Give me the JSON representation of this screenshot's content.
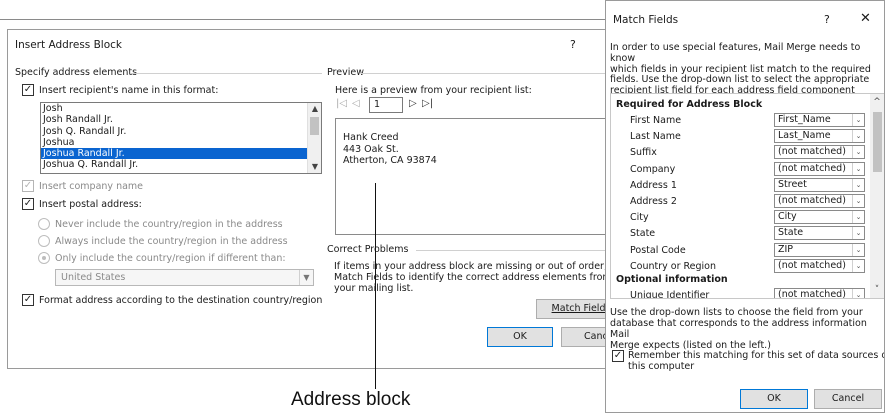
{
  "insert_dialog": {
    "title": "Insert Address Block",
    "help": "?",
    "specify_label": "Specify address elements",
    "insert_name_label": "Insert recipient's name in this format:",
    "name_formats": [
      {
        "label": "Josh",
        "selected": false
      },
      {
        "label": "Josh Randall Jr.",
        "selected": false
      },
      {
        "label": "Josh Q. Randall Jr.",
        "selected": false
      },
      {
        "label": "Joshua",
        "selected": false
      },
      {
        "label": "Joshua Randall Jr.",
        "selected": true
      },
      {
        "label": "Joshua Q. Randall Jr.",
        "selected": false
      }
    ],
    "insert_company_label": "Insert company name",
    "insert_postal_label": "Insert postal address:",
    "radio_never": "Never include the country/region in the address",
    "radio_always": "Always include the country/region in the address",
    "radio_only": "Only include the country/region if different than:",
    "country_value": "United States",
    "format_label": "Format address according to the destination country/region",
    "preview_label": "Preview",
    "preview_hint": "Here is a preview from your recipient list:",
    "preview_index": "1",
    "preview_address": [
      "Hank Creed",
      "443 Oak St.",
      "Atherton, CA 93874"
    ],
    "correct_problems_label": "Correct Problems",
    "problems_text": [
      "If items in your address block are missing or out of order, u",
      "Match Fields to identify the correct address elements from",
      "your mailing list."
    ],
    "match_fields_button": "Match Fields",
    "ok_button": "OK",
    "cancel_button": "Cance"
  },
  "callout": {
    "label": "Address block"
  },
  "match_dialog": {
    "title": "Match Fields",
    "help": "?",
    "close": "✕",
    "intro": [
      "In order to use special features, Mail Merge needs to know",
      "which fields in your recipient list match to the required",
      "fields.  Use the drop-down list to select the appropriate",
      "recipient list field for each address field component"
    ],
    "required_heading": "Required for Address Block",
    "required_fields": [
      {
        "name": "First Name",
        "value": "First_Name"
      },
      {
        "name": "Last Name",
        "value": "Last_Name"
      },
      {
        "name": "Suffix",
        "value": "(not matched)"
      },
      {
        "name": "Company",
        "value": "(not matched)"
      },
      {
        "name": "Address 1",
        "value": "Street"
      },
      {
        "name": "Address 2",
        "value": "(not matched)"
      },
      {
        "name": "City",
        "value": "City"
      },
      {
        "name": "State",
        "value": "State"
      },
      {
        "name": "Postal Code",
        "value": "ZIP"
      },
      {
        "name": "Country or Region",
        "value": "(not matched)"
      }
    ],
    "optional_heading": "Optional information",
    "optional_fields": [
      {
        "name": "Unique Identifier",
        "value": "(not matched)"
      }
    ],
    "hint": [
      "Use the drop-down lists to choose the field from your",
      "database that corresponds to the address information Mail",
      "Merge expects (listed on the left.)"
    ],
    "remember_label_1": "Remember this matching for this set of data sources on",
    "remember_label_2": "this computer",
    "ok_button": "OK",
    "cancel_button": "Cancel"
  }
}
